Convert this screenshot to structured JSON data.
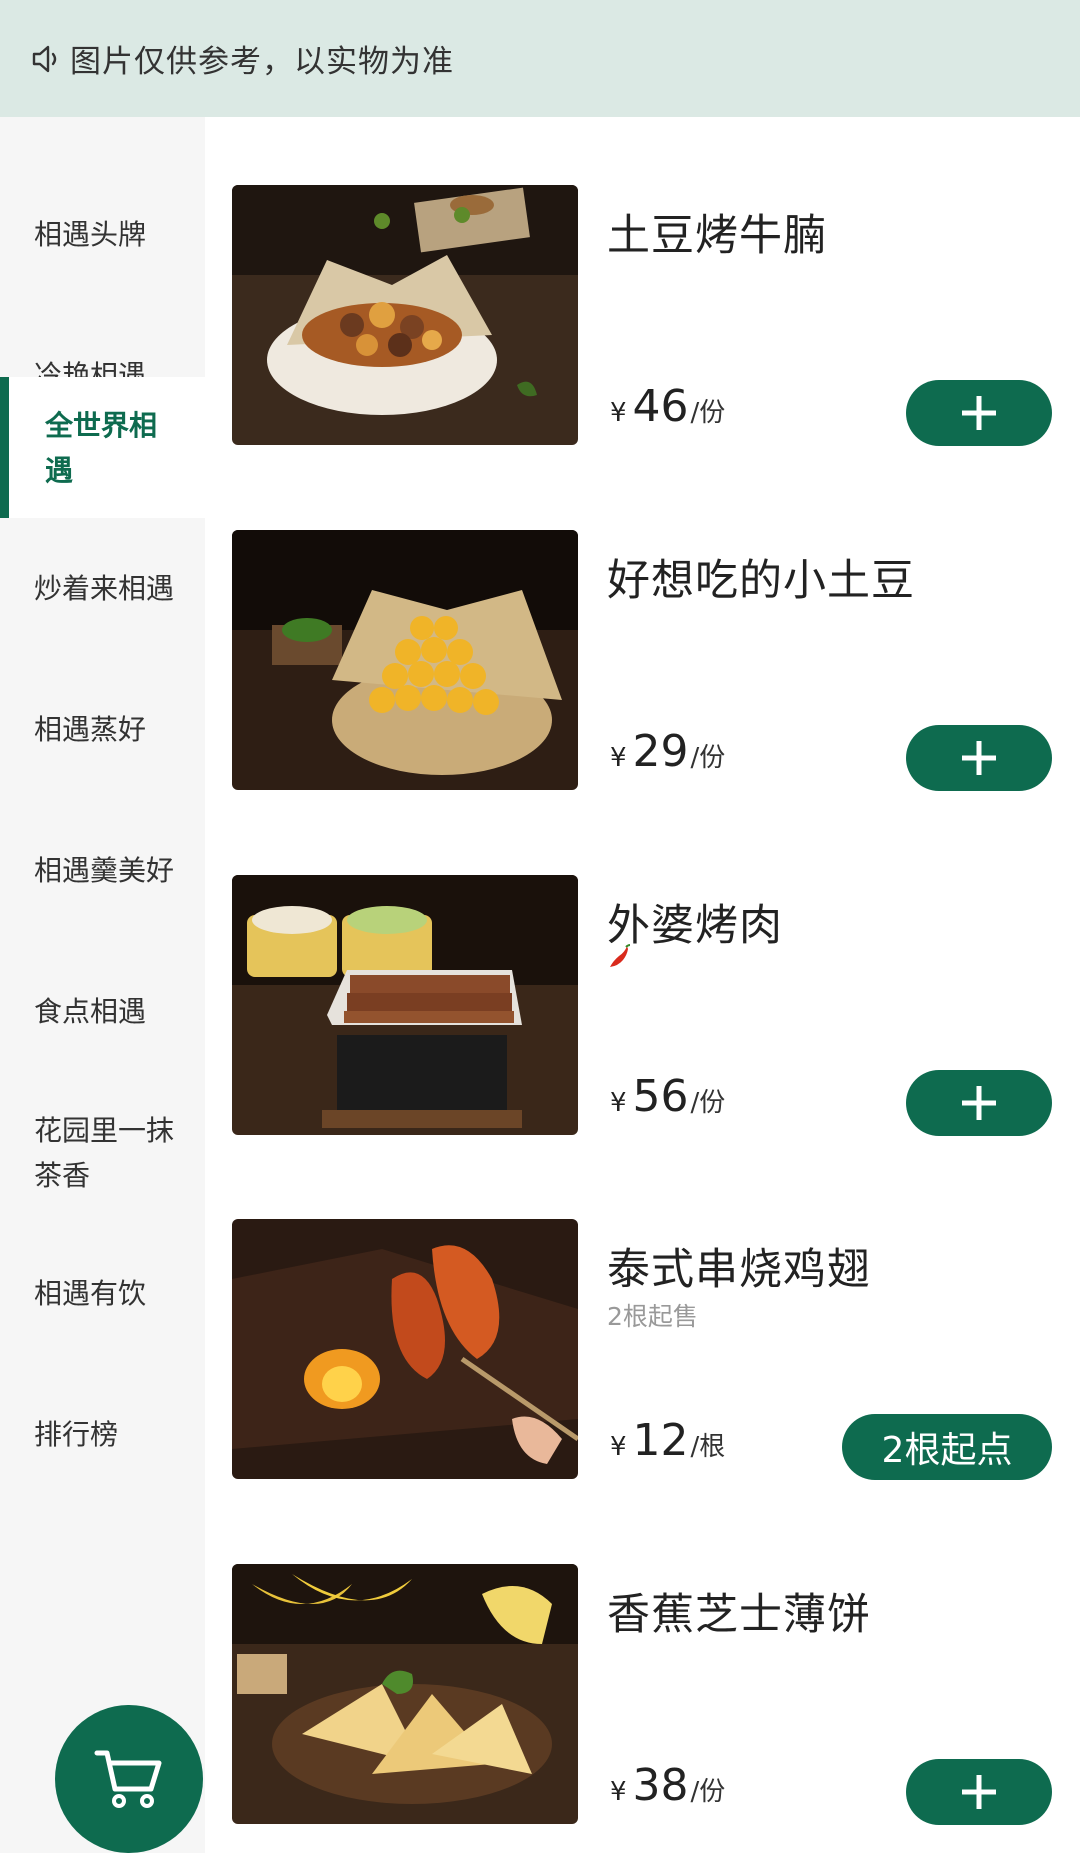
{
  "notice": {
    "icon": "speaker-icon",
    "text": "图片仅供参考，以实物为准"
  },
  "sidebar": {
    "items": [
      {
        "label": "相遇头牌",
        "active": false
      },
      {
        "label": "冷艳相遇",
        "active": false
      },
      {
        "label": "全世界相遇",
        "active": true
      },
      {
        "label": "炒着来相遇",
        "active": false
      },
      {
        "label": "相遇蒸好",
        "active": false
      },
      {
        "label": "相遇羹美好",
        "active": false
      },
      {
        "label": "食点相遇",
        "active": false
      },
      {
        "label": "花园里一抹茶香",
        "active": false
      },
      {
        "label": "相遇有饮",
        "active": false
      },
      {
        "label": "排行榜",
        "active": false
      }
    ]
  },
  "products": [
    {
      "name": "土豆烤牛腩",
      "currency": "¥",
      "price": "46",
      "unit": "/份",
      "action_icon": "plus-icon"
    },
    {
      "name": "好想吃的小土豆",
      "currency": "¥",
      "price": "29",
      "unit": "/份",
      "action_icon": "plus-icon"
    },
    {
      "name": "外婆烤肉",
      "tag_icon": "chili-icon",
      "currency": "¥",
      "price": "56",
      "unit": "/份",
      "action_icon": "plus-icon"
    },
    {
      "name": "泰式串烧鸡翅",
      "subtitle": "2根起售",
      "currency": "¥",
      "price": "12",
      "unit": "/根",
      "action_label": "2根起点"
    },
    {
      "name": "香蕉芝士薄饼",
      "currency": "¥",
      "price": "38",
      "unit": "/份",
      "action_icon": "plus-icon"
    }
  ],
  "cart": {
    "icon": "cart-icon"
  },
  "colors": {
    "brand": "#0e6b4f",
    "notice_bg": "#dbe9e4",
    "sidebar_bg": "#f6f6f6"
  }
}
